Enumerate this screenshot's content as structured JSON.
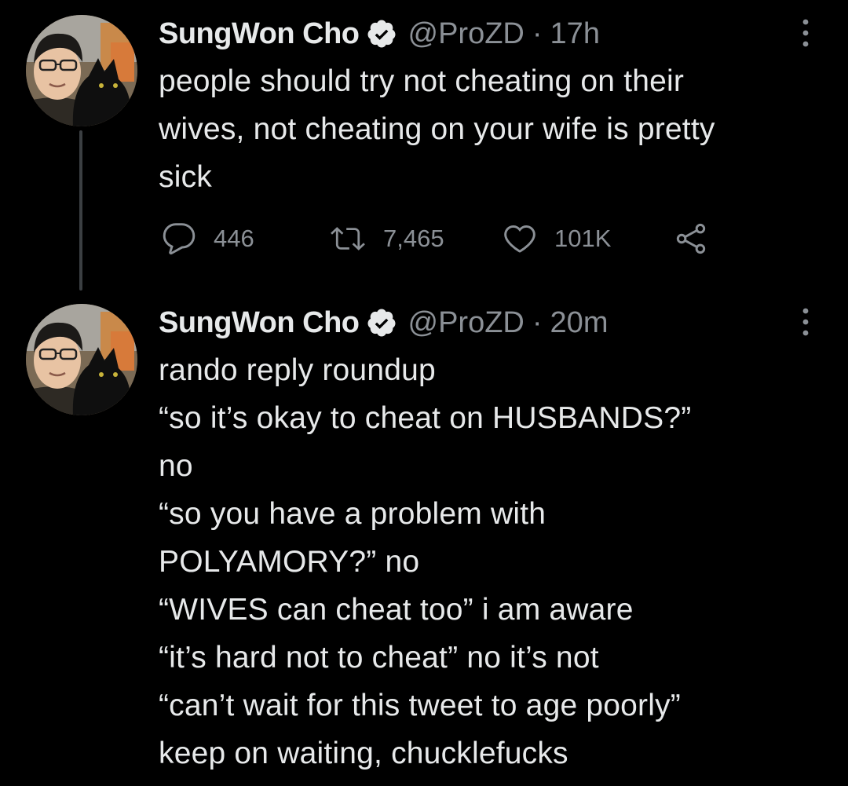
{
  "colors": {
    "background": "#000000",
    "text": "#e7e9ea",
    "muted": "#8b9096",
    "thread_line": "#3b3f42",
    "verified_badge": "#e7e9ea"
  },
  "tweets": [
    {
      "display_name": "SungWon Cho",
      "verified_icon": "verified-badge-icon",
      "handle": "@ProZD",
      "separator": "·",
      "time": "17h",
      "text": "people should try not cheating on their\nwives, not cheating on your wife is pretty\nsick",
      "actions": {
        "reply_icon": "reply-icon",
        "reply_count": "446",
        "retweet_icon": "retweet-icon",
        "retweet_count": "7,465",
        "like_icon": "heart-icon",
        "like_count": "101K",
        "share_icon": "share-icon"
      }
    },
    {
      "display_name": "SungWon Cho",
      "verified_icon": "verified-badge-icon",
      "handle": "@ProZD",
      "separator": "·",
      "time": "20m",
      "text": "rando reply roundup\n“so it’s okay to cheat on HUSBANDS?”\nno\n“so you have a problem with\nPOLYAMORY?” no\n“WIVES can cheat too” i am aware\n“it’s hard not to cheat” no it’s not\n“can’t wait for this tweet to age poorly”\nkeep on waiting, chucklefucks"
    }
  ]
}
